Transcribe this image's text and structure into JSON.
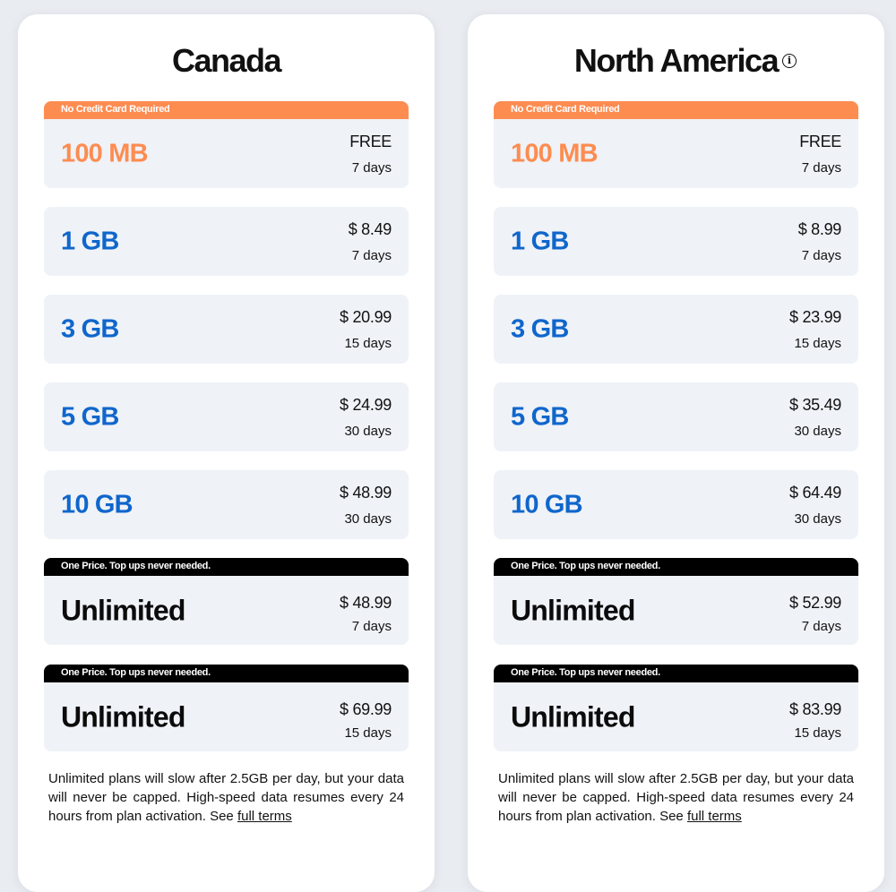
{
  "regions": [
    {
      "title": "Canada",
      "has_info_icon": false,
      "plans": [
        {
          "banner": "No Credit Card Required",
          "banner_style": "orange",
          "size": "100 MB",
          "size_style": "orange",
          "price": "FREE",
          "duration": "7 days"
        },
        {
          "banner": null,
          "size": "1 GB",
          "size_style": "blue",
          "price": "$ 8.49",
          "duration": "7 days"
        },
        {
          "banner": null,
          "size": "3 GB",
          "size_style": "blue",
          "price": "$ 20.99",
          "duration": "15 days"
        },
        {
          "banner": null,
          "size": "5 GB",
          "size_style": "blue",
          "price": "$ 24.99",
          "duration": "30 days"
        },
        {
          "banner": null,
          "size": "10 GB",
          "size_style": "blue",
          "price": "$ 48.99",
          "duration": "30 days"
        },
        {
          "banner": "One Price. Top ups never needed.",
          "banner_style": "black",
          "size": "Unlimited",
          "size_style": "black",
          "price": "$ 48.99",
          "duration": "7 days"
        },
        {
          "banner": "One Price. Top ups never needed.",
          "banner_style": "black",
          "size": "Unlimited",
          "size_style": "black",
          "price": "$ 69.99",
          "duration": "15 days"
        }
      ],
      "footnote_text": "Unlimited plans will slow after 2.5GB per day, but your data will never be capped. High-speed data resumes every 24 hours from plan activation. See ",
      "footnote_link": "full terms"
    },
    {
      "title": "North America",
      "has_info_icon": true,
      "info_icon_glyph": "i",
      "plans": [
        {
          "banner": "No Credit Card Required",
          "banner_style": "orange",
          "size": "100 MB",
          "size_style": "orange",
          "price": "FREE",
          "duration": "7 days"
        },
        {
          "banner": null,
          "size": "1 GB",
          "size_style": "blue",
          "price": "$ 8.99",
          "duration": "7 days"
        },
        {
          "banner": null,
          "size": "3 GB",
          "size_style": "blue",
          "price": "$ 23.99",
          "duration": "15 days"
        },
        {
          "banner": null,
          "size": "5 GB",
          "size_style": "blue",
          "price": "$ 35.49",
          "duration": "30 days"
        },
        {
          "banner": null,
          "size": "10 GB",
          "size_style": "blue",
          "price": "$ 64.49",
          "duration": "30 days"
        },
        {
          "banner": "One Price. Top ups never needed.",
          "banner_style": "black",
          "size": "Unlimited",
          "size_style": "black",
          "price": "$ 52.99",
          "duration": "7 days"
        },
        {
          "banner": "One Price. Top ups never needed.",
          "banner_style": "black",
          "size": "Unlimited",
          "size_style": "black",
          "price": "$ 83.99",
          "duration": "15 days"
        }
      ],
      "footnote_text": "Unlimited plans will slow after 2.5GB per day, but your data will never be capped. High-speed data resumes every 24 hours from plan activation. See ",
      "footnote_link": "full terms"
    }
  ],
  "colors": {
    "accent_orange": "#fd8c51",
    "accent_blue": "#0f66cc",
    "plan_background": "#eff2f7",
    "page_background": "#e9ecf1"
  }
}
